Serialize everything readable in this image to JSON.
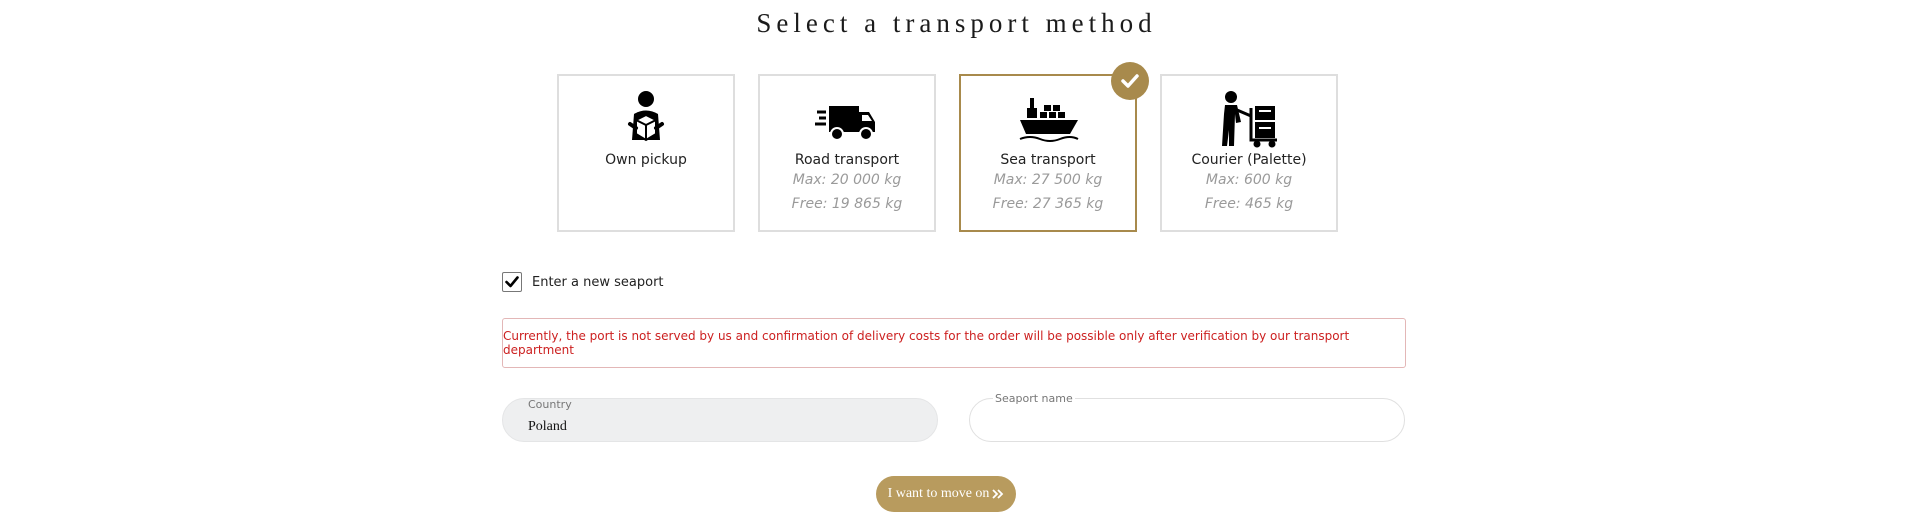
{
  "page": {
    "title": "Select a transport method"
  },
  "transport": {
    "options": [
      {
        "name": "Own pickup",
        "icon": "person-with-box-icon",
        "max": "",
        "free": "",
        "selected": false
      },
      {
        "name": "Road transport",
        "icon": "delivery-truck-icon",
        "max": "Max: 20 000 kg",
        "free": "Free: 19 865 kg",
        "selected": false
      },
      {
        "name": "Sea transport",
        "icon": "cargo-ship-icon",
        "max": "Max: 27 500 kg",
        "free": "Free: 27 365 kg",
        "selected": true
      },
      {
        "name": "Courier (Palette)",
        "icon": "courier-cart-icon",
        "max": "Max: 600 kg",
        "free": "Free: 465 kg",
        "selected": false
      }
    ],
    "selected_badge_icon": "checkmark-icon"
  },
  "seaport": {
    "checkbox_label": "Enter a new seaport",
    "checkbox_checked": true,
    "alert": "Currently, the port is not served by us and confirmation of delivery costs for the order will be possible only after verification by our transport department",
    "country_label": "Country",
    "country_value": "Poland",
    "seaport_label": "Seaport name",
    "seaport_value": ""
  },
  "actions": {
    "move_on_label": "I want to move on",
    "move_on_icon": "double-chevron-right-icon"
  },
  "colors": {
    "accent": "#a88a4c",
    "button": "#b89b5e",
    "alert_text": "#cc1f1f",
    "alert_border": "#e3b7b7"
  }
}
